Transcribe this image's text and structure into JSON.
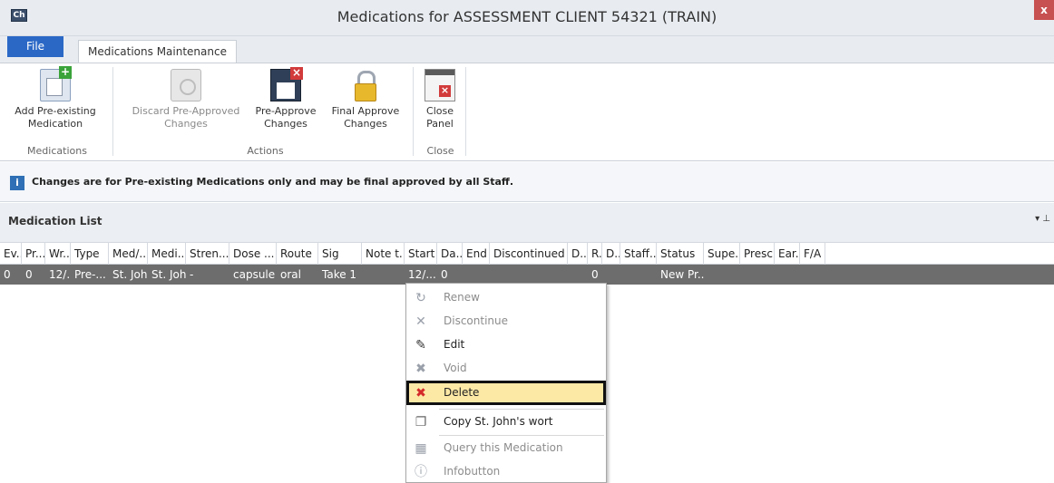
{
  "window": {
    "app_icon": "Ch",
    "title": "Medications for ASSESSMENT CLIENT 54321 (TRAIN)",
    "close": "x"
  },
  "tabs": {
    "file": "File",
    "maintenance": "Medications Maintenance"
  },
  "ribbon": {
    "buttons": [
      {
        "label": "Add Pre-existing Medication",
        "icon": "add-medication-icon"
      },
      {
        "label": "Discard Pre-Approved Changes",
        "icon": "discard-icon"
      },
      {
        "label": "Pre-Approve Changes",
        "icon": "pre-approve-icon"
      },
      {
        "label": "Final Approve Changes",
        "icon": "lock-icon"
      },
      {
        "label": "Close Panel",
        "icon": "close-panel-icon"
      }
    ],
    "groups": [
      "Medications",
      "Actions",
      "Close"
    ]
  },
  "info": {
    "icon": "i",
    "text": "Changes are for Pre-existing Medications only and may be final approved by all Staff."
  },
  "list": {
    "title": "Medication List",
    "controls": "▾ ⊥",
    "columns": [
      "Ev...",
      "Pr...",
      "Wr...",
      "Type",
      "Med/...",
      "Medi...",
      "Stren...",
      "Dose ...",
      "Route",
      "Sig",
      "Note t...",
      "Start",
      "Da...",
      "End",
      "Discontinued",
      "D...",
      "R.",
      "D...",
      "Staff...",
      "Status",
      "Supe...",
      "Presc...",
      "Ear...",
      "F/A"
    ],
    "row": [
      "0",
      "0",
      "12/...",
      "Pre-...",
      "St. Joh...",
      "St. Joh...",
      "-",
      "capsule",
      "oral",
      "Take 1",
      "",
      "12/...",
      "0",
      "",
      "",
      "",
      "0",
      "",
      "",
      "New Pr...",
      "",
      "",
      "",
      ""
    ]
  },
  "context_menu": {
    "items": [
      {
        "label": "Renew",
        "icon": "renew-icon",
        "enabled": false
      },
      {
        "label": "Discontinue",
        "icon": "discontinue-icon",
        "enabled": false
      },
      {
        "label": "Edit",
        "icon": "edit-icon",
        "enabled": true
      },
      {
        "label": "Void",
        "icon": "void-icon",
        "enabled": false
      },
      {
        "label": "Delete",
        "icon": "delete-icon",
        "enabled": true,
        "selected": true
      },
      {
        "label": "Copy St. John's wort",
        "icon": "copy-icon",
        "enabled": true
      },
      {
        "label": "Query this Medication",
        "icon": "query-icon",
        "enabled": false
      },
      {
        "label": "Infobutton",
        "icon": "info-icon",
        "enabled": false
      }
    ]
  }
}
